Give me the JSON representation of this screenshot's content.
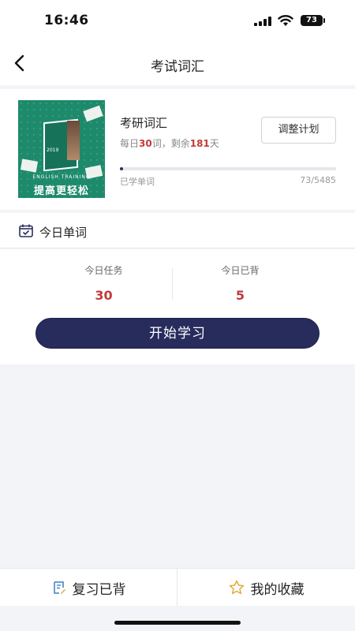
{
  "status_bar": {
    "time": "16:46",
    "battery": "73"
  },
  "nav": {
    "title": "考试词汇"
  },
  "book": {
    "cover_year": "2019",
    "cover_en": "ENGLISH TRAINING",
    "cover_zh": "提高更轻松",
    "title": "考研词汇",
    "plan_prefix": "每日",
    "daily_count": "30",
    "plan_mid": "词，剩余",
    "days_left": "181",
    "plan_suffix": "天",
    "adjust_label": "调整计划",
    "learned_label": "已学单词",
    "learned_count": "73/5485",
    "progress_fraction": 0.0133
  },
  "today": {
    "title": "今日单词",
    "task_label": "今日任务",
    "task_value": "30",
    "done_label": "今日已背",
    "done_value": "5",
    "start_label": "开始学习"
  },
  "bottom": {
    "review_label": "复习已背",
    "favorites_label": "我的收藏"
  },
  "colors": {
    "accent": "#272c5d",
    "highlight": "#c23a3a",
    "cover": "#1d8a6b",
    "star": "#e2a93b"
  }
}
